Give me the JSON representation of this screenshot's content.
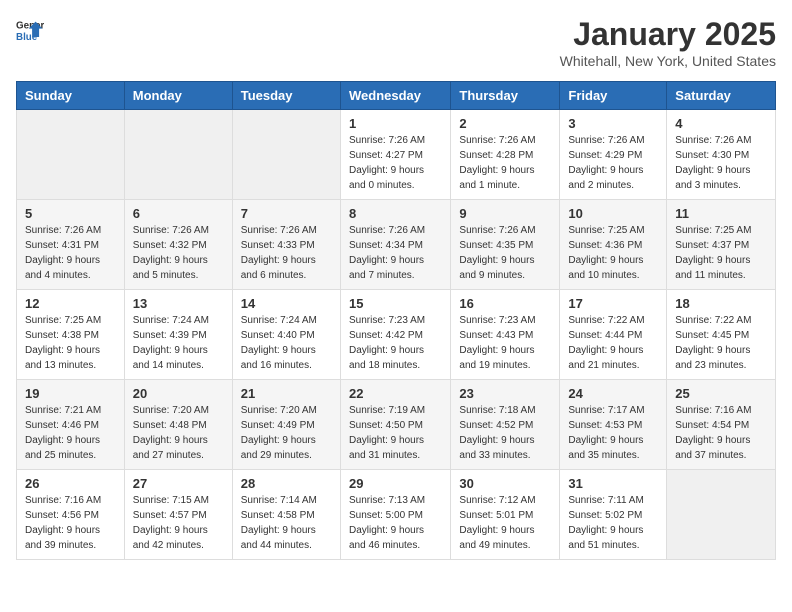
{
  "header": {
    "logo_general": "General",
    "logo_blue": "Blue",
    "month": "January 2025",
    "location": "Whitehall, New York, United States"
  },
  "days_of_week": [
    "Sunday",
    "Monday",
    "Tuesday",
    "Wednesday",
    "Thursday",
    "Friday",
    "Saturday"
  ],
  "weeks": [
    [
      {
        "day": "",
        "sunrise": "",
        "sunset": "",
        "daylight": ""
      },
      {
        "day": "",
        "sunrise": "",
        "sunset": "",
        "daylight": ""
      },
      {
        "day": "",
        "sunrise": "",
        "sunset": "",
        "daylight": ""
      },
      {
        "day": "1",
        "sunrise": "Sunrise: 7:26 AM",
        "sunset": "Sunset: 4:27 PM",
        "daylight": "Daylight: 9 hours and 0 minutes."
      },
      {
        "day": "2",
        "sunrise": "Sunrise: 7:26 AM",
        "sunset": "Sunset: 4:28 PM",
        "daylight": "Daylight: 9 hours and 1 minute."
      },
      {
        "day": "3",
        "sunrise": "Sunrise: 7:26 AM",
        "sunset": "Sunset: 4:29 PM",
        "daylight": "Daylight: 9 hours and 2 minutes."
      },
      {
        "day": "4",
        "sunrise": "Sunrise: 7:26 AM",
        "sunset": "Sunset: 4:30 PM",
        "daylight": "Daylight: 9 hours and 3 minutes."
      }
    ],
    [
      {
        "day": "5",
        "sunrise": "Sunrise: 7:26 AM",
        "sunset": "Sunset: 4:31 PM",
        "daylight": "Daylight: 9 hours and 4 minutes."
      },
      {
        "day": "6",
        "sunrise": "Sunrise: 7:26 AM",
        "sunset": "Sunset: 4:32 PM",
        "daylight": "Daylight: 9 hours and 5 minutes."
      },
      {
        "day": "7",
        "sunrise": "Sunrise: 7:26 AM",
        "sunset": "Sunset: 4:33 PM",
        "daylight": "Daylight: 9 hours and 6 minutes."
      },
      {
        "day": "8",
        "sunrise": "Sunrise: 7:26 AM",
        "sunset": "Sunset: 4:34 PM",
        "daylight": "Daylight: 9 hours and 7 minutes."
      },
      {
        "day": "9",
        "sunrise": "Sunrise: 7:26 AM",
        "sunset": "Sunset: 4:35 PM",
        "daylight": "Daylight: 9 hours and 9 minutes."
      },
      {
        "day": "10",
        "sunrise": "Sunrise: 7:25 AM",
        "sunset": "Sunset: 4:36 PM",
        "daylight": "Daylight: 9 hours and 10 minutes."
      },
      {
        "day": "11",
        "sunrise": "Sunrise: 7:25 AM",
        "sunset": "Sunset: 4:37 PM",
        "daylight": "Daylight: 9 hours and 11 minutes."
      }
    ],
    [
      {
        "day": "12",
        "sunrise": "Sunrise: 7:25 AM",
        "sunset": "Sunset: 4:38 PM",
        "daylight": "Daylight: 9 hours and 13 minutes."
      },
      {
        "day": "13",
        "sunrise": "Sunrise: 7:24 AM",
        "sunset": "Sunset: 4:39 PM",
        "daylight": "Daylight: 9 hours and 14 minutes."
      },
      {
        "day": "14",
        "sunrise": "Sunrise: 7:24 AM",
        "sunset": "Sunset: 4:40 PM",
        "daylight": "Daylight: 9 hours and 16 minutes."
      },
      {
        "day": "15",
        "sunrise": "Sunrise: 7:23 AM",
        "sunset": "Sunset: 4:42 PM",
        "daylight": "Daylight: 9 hours and 18 minutes."
      },
      {
        "day": "16",
        "sunrise": "Sunrise: 7:23 AM",
        "sunset": "Sunset: 4:43 PM",
        "daylight": "Daylight: 9 hours and 19 minutes."
      },
      {
        "day": "17",
        "sunrise": "Sunrise: 7:22 AM",
        "sunset": "Sunset: 4:44 PM",
        "daylight": "Daylight: 9 hours and 21 minutes."
      },
      {
        "day": "18",
        "sunrise": "Sunrise: 7:22 AM",
        "sunset": "Sunset: 4:45 PM",
        "daylight": "Daylight: 9 hours and 23 minutes."
      }
    ],
    [
      {
        "day": "19",
        "sunrise": "Sunrise: 7:21 AM",
        "sunset": "Sunset: 4:46 PM",
        "daylight": "Daylight: 9 hours and 25 minutes."
      },
      {
        "day": "20",
        "sunrise": "Sunrise: 7:20 AM",
        "sunset": "Sunset: 4:48 PM",
        "daylight": "Daylight: 9 hours and 27 minutes."
      },
      {
        "day": "21",
        "sunrise": "Sunrise: 7:20 AM",
        "sunset": "Sunset: 4:49 PM",
        "daylight": "Daylight: 9 hours and 29 minutes."
      },
      {
        "day": "22",
        "sunrise": "Sunrise: 7:19 AM",
        "sunset": "Sunset: 4:50 PM",
        "daylight": "Daylight: 9 hours and 31 minutes."
      },
      {
        "day": "23",
        "sunrise": "Sunrise: 7:18 AM",
        "sunset": "Sunset: 4:52 PM",
        "daylight": "Daylight: 9 hours and 33 minutes."
      },
      {
        "day": "24",
        "sunrise": "Sunrise: 7:17 AM",
        "sunset": "Sunset: 4:53 PM",
        "daylight": "Daylight: 9 hours and 35 minutes."
      },
      {
        "day": "25",
        "sunrise": "Sunrise: 7:16 AM",
        "sunset": "Sunset: 4:54 PM",
        "daylight": "Daylight: 9 hours and 37 minutes."
      }
    ],
    [
      {
        "day": "26",
        "sunrise": "Sunrise: 7:16 AM",
        "sunset": "Sunset: 4:56 PM",
        "daylight": "Daylight: 9 hours and 39 minutes."
      },
      {
        "day": "27",
        "sunrise": "Sunrise: 7:15 AM",
        "sunset": "Sunset: 4:57 PM",
        "daylight": "Daylight: 9 hours and 42 minutes."
      },
      {
        "day": "28",
        "sunrise": "Sunrise: 7:14 AM",
        "sunset": "Sunset: 4:58 PM",
        "daylight": "Daylight: 9 hours and 44 minutes."
      },
      {
        "day": "29",
        "sunrise": "Sunrise: 7:13 AM",
        "sunset": "Sunset: 5:00 PM",
        "daylight": "Daylight: 9 hours and 46 minutes."
      },
      {
        "day": "30",
        "sunrise": "Sunrise: 7:12 AM",
        "sunset": "Sunset: 5:01 PM",
        "daylight": "Daylight: 9 hours and 49 minutes."
      },
      {
        "day": "31",
        "sunrise": "Sunrise: 7:11 AM",
        "sunset": "Sunset: 5:02 PM",
        "daylight": "Daylight: 9 hours and 51 minutes."
      },
      {
        "day": "",
        "sunrise": "",
        "sunset": "",
        "daylight": ""
      }
    ]
  ]
}
